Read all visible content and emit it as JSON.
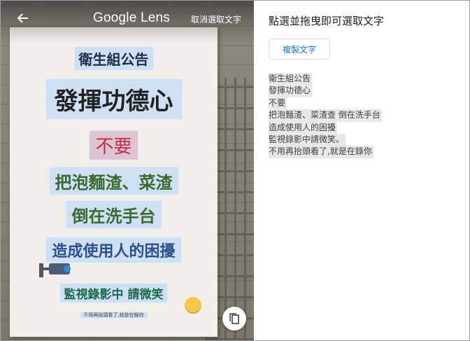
{
  "lens": {
    "title": "Google Lens",
    "cancel_select_label": "取消選取文字",
    "back_icon": "arrow-left-icon",
    "copy_icon": "copy-icon"
  },
  "poster": {
    "title": "衛生組公告",
    "headline": "發揮功德心",
    "no": "不要",
    "line1": "把泡麵渣、菜渣",
    "line2": "倒在洗手台",
    "line3": "造成使用人的困擾",
    "line4": "監視錄影中 請微笑",
    "footer": "不用再抬頭看了,就是在錄你"
  },
  "panel": {
    "title": "點選並拖曳即可選取文字",
    "copy_label": "複製文字",
    "text_lines": [
      "衛生組公告",
      "發揮功德心",
      "不要",
      "把泡麵渣、菜渣查 倒在洗手台",
      "造成使用人的困擾",
      "監視錄影中請微笑。",
      "不用再抬頭看了,就是在錄你"
    ]
  },
  "colors": {
    "accent": "#1a73e8",
    "highlight": "#e8e8e8"
  }
}
